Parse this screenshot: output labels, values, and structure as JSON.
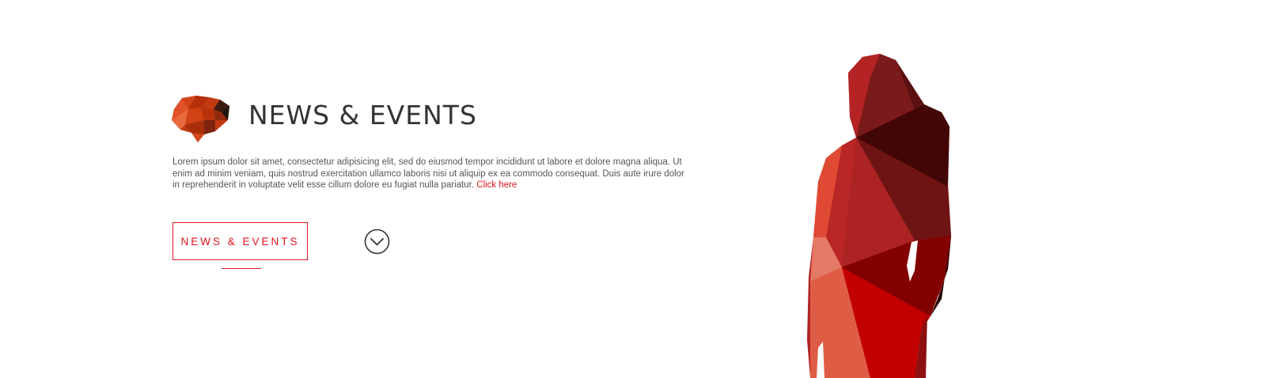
{
  "section": {
    "title": "NEWS & EVENTS",
    "description": "Lorem ipsum dolor sit amet, consectetur adipisicing elit, sed do eiusmod tempor incididunt ut labore et dolore magna aliqua. Ut enim ad minim veniam, quis nostrud exercitation ullamco laboris nisi ut aliquip ex ea commodo consequat. Duis aute irure dolor in reprehenderit in voluptate velit esse cillum dolore eu fugiat nulla pariatur.",
    "link_label": "Click here",
    "button_label": "NEWS & EVENTS"
  },
  "icons": {
    "logo": "low-poly-brain-icon",
    "scroll": "chevron-down-circle-icon",
    "hero": "low-poly-person-silhouette"
  },
  "colors": {
    "accent": "#e0131d",
    "title": "#333333",
    "body_text": "#555555",
    "background": "#ffffff"
  }
}
